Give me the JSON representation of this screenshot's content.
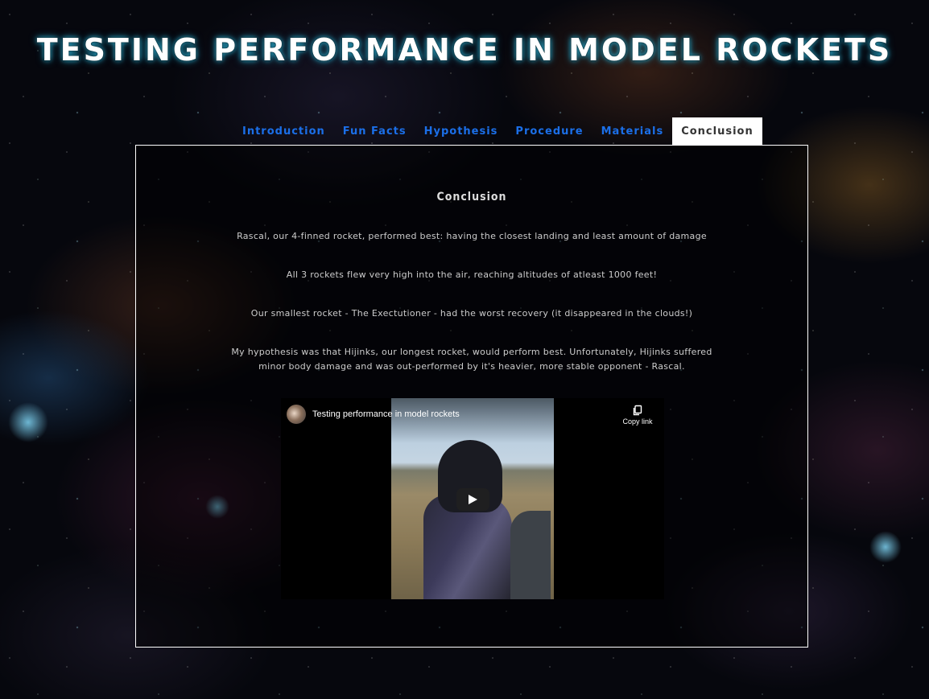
{
  "page": {
    "title": "TESTING PERFORMANCE IN MODEL ROCKETS"
  },
  "tabs": [
    {
      "label": "Introduction",
      "active": false
    },
    {
      "label": "Fun Facts",
      "active": false
    },
    {
      "label": "Hypothesis",
      "active": false
    },
    {
      "label": "Procedure",
      "active": false
    },
    {
      "label": "Materials",
      "active": false
    },
    {
      "label": "Conclusion",
      "active": true
    }
  ],
  "conclusion": {
    "heading": "Conclusion",
    "paragraphs": [
      "Rascal, our 4-finned rocket, performed best: having the closest landing and least amount of damage",
      "All 3 rockets flew very high into the air, reaching altitudes of atleast 1000 feet!",
      "Our smallest rocket - The Exectutioner - had the worst recovery (it disappeared in the clouds!)",
      "My hypothesis was that Hijinks, our longest rocket, would perform best. Unfortunately, Hijinks suffered minor body damage and was out-performed by it's heavier, more stable opponent - Rascal."
    ]
  },
  "video": {
    "title": "Testing performance in model rockets",
    "copy_link_label": "Copy link",
    "icons": {
      "copy": "copy-link-icon",
      "play": "play-icon",
      "avatar": "channel-avatar"
    }
  },
  "colors": {
    "tab_text": "#1b6fe8",
    "active_tab_bg": "#ffffff",
    "active_tab_text": "#333333",
    "title_glow": "#2aa7c8",
    "panel_border": "#ffffff",
    "body_text": "#cccccc"
  }
}
